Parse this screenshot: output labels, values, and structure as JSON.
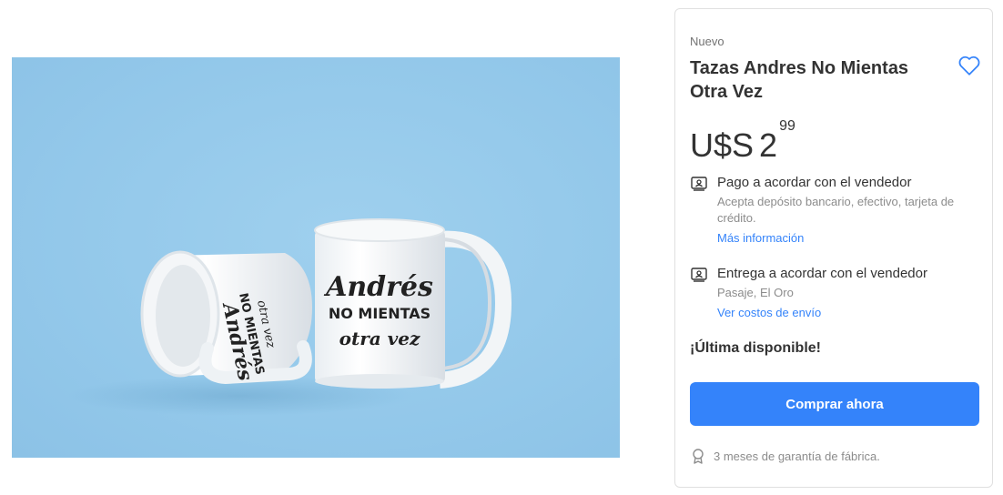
{
  "product": {
    "condition": "Nuevo",
    "title": "Tazas Andres No Mientas Otra Vez",
    "price_currency": "U$S",
    "price_integer": "2",
    "price_cents": "99",
    "accent_color": "#3483fa"
  },
  "payment": {
    "icon": "payment-card-icon",
    "title": "Pago a acordar con el vendedor",
    "subtitle": "Acepta depósito bancario, efectivo, tarjeta de crédito.",
    "link": "Más información"
  },
  "shipping": {
    "icon": "delivery-icon",
    "title": "Entrega a acordar con el vendedor",
    "subtitle": "Pasaje, El Oro",
    "link": "Ver costos de envío"
  },
  "stock_text": "¡Última disponible!",
  "buy_button": "Comprar ahora",
  "warranty": "3 meses de garantía de fábrica.",
  "mug_text": {
    "line1": "Andrés",
    "line2": "NO MIENTAS",
    "line3": "otra vez"
  }
}
